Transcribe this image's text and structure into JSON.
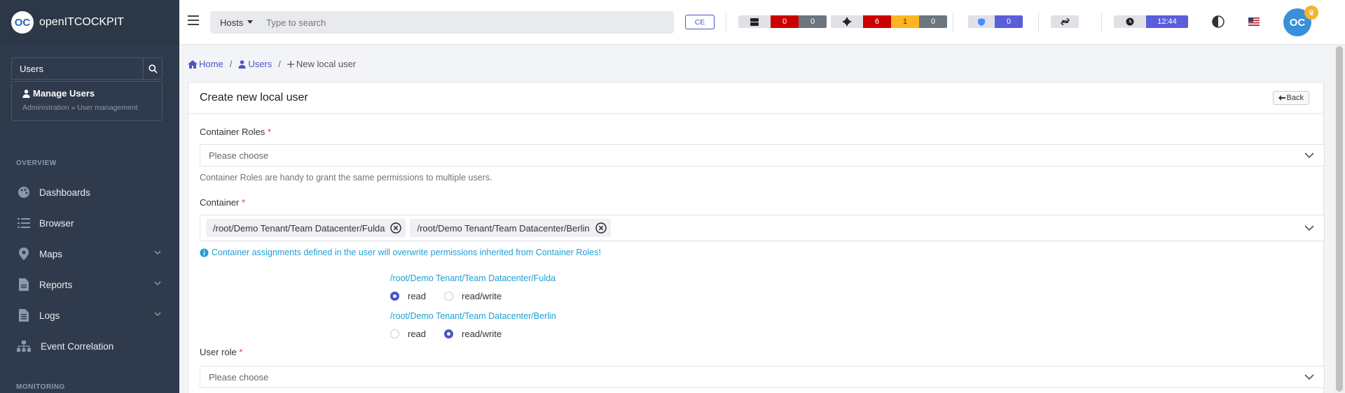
{
  "app": {
    "name": "openITCOCKPIT",
    "logo_text": "OC"
  },
  "sidebar": {
    "search_value": "Users",
    "result": {
      "title": "Manage Users",
      "subtitle": "Administration » User management"
    },
    "section_overview": "OVERVIEW",
    "section_monitoring": "MONITORING",
    "items": [
      {
        "label": "Dashboards",
        "icon": "palette-icon",
        "has_chevron": false
      },
      {
        "label": "Browser",
        "icon": "list-icon",
        "has_chevron": false
      },
      {
        "label": "Maps",
        "icon": "map-marker-icon",
        "has_chevron": true
      },
      {
        "label": "Reports",
        "icon": "file-icon",
        "has_chevron": true
      },
      {
        "label": "Logs",
        "icon": "file-text-icon",
        "has_chevron": true
      },
      {
        "label": "Event Correlation",
        "icon": "sitemap-icon",
        "has_chevron": false
      }
    ]
  },
  "topbar": {
    "search_type": "Hosts",
    "search_placeholder": "Type to search",
    "edition": "CE",
    "hosts_counts": [
      "0",
      "0"
    ],
    "services_counts": [
      "6",
      "1",
      "0"
    ],
    "shield_count": "0",
    "clock": "12:44",
    "colors": {
      "critical": "#cc0000",
      "warning": "#fdb525",
      "gray": "#6c757d",
      "accent": "#5a5ed9"
    }
  },
  "breadcrumb": {
    "home": "Home",
    "users": "Users",
    "current": "New local user"
  },
  "form": {
    "title": "Create new local user",
    "back_label": "Back",
    "container_roles_label": "Container Roles",
    "container_roles_placeholder": "Please choose",
    "container_roles_help": "Container Roles are handy to grant the same permissions to multiple users.",
    "container_label": "Container",
    "container_tags": [
      "/root/Demo Tenant/Team Datacenter/Fulda",
      "/root/Demo Tenant/Team Datacenter/Berlin"
    ],
    "info_text": "Container assignments defined in the user will overwrite permissions inherited from Container Roles!",
    "permissions": [
      {
        "path": "/root/Demo Tenant/Team Datacenter/Fulda",
        "read": "read",
        "read_write": "read/write",
        "selected": "read"
      },
      {
        "path": "/root/Demo Tenant/Team Datacenter/Berlin",
        "read": "read",
        "read_write": "read/write",
        "selected": "read/write"
      }
    ],
    "user_role_label": "User role",
    "user_role_placeholder": "Please choose",
    "required_mark": "*"
  }
}
